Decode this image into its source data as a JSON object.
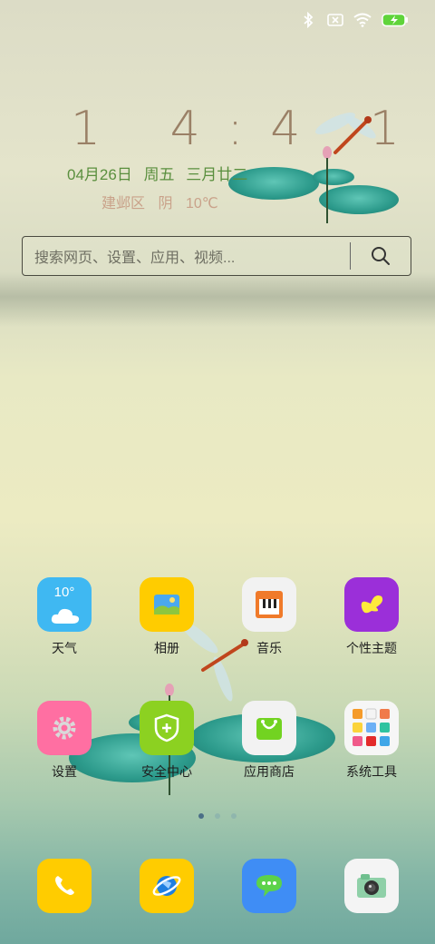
{
  "status_bar": {
    "icons": [
      "bluetooth-icon",
      "no-sim-icon",
      "wifi-icon",
      "battery-charging-icon"
    ]
  },
  "clock": {
    "time": "1 4:4 1",
    "date": "04月26日",
    "weekday": "周五",
    "lunar": "三月廿二",
    "location": "建邺区",
    "weather": "阴",
    "temperature": "10℃"
  },
  "search": {
    "placeholder": "搜索网页、设置、应用、视频...",
    "icon": "search-icon"
  },
  "apps": [
    {
      "label": "天气",
      "icon": "weather-icon",
      "badge": "10°",
      "color": "#3fb8f2"
    },
    {
      "label": "相册",
      "icon": "gallery-icon",
      "color": "#ffcc00"
    },
    {
      "label": "音乐",
      "icon": "music-icon",
      "color": "#f2f2f2"
    },
    {
      "label": "个性主题",
      "icon": "theme-icon",
      "color": "#9b2fd9"
    },
    {
      "label": "设置",
      "icon": "settings-gear-icon",
      "color": "#ff6fa2"
    },
    {
      "label": "安全中心",
      "icon": "security-shield-icon",
      "color": "#8cd121"
    },
    {
      "label": "应用商店",
      "icon": "app-store-icon",
      "color": "#f2f2f2"
    },
    {
      "label": "系统工具",
      "icon": "system-tools-folder-icon",
      "color": "#f6f6f6"
    }
  ],
  "pages": {
    "count": 3,
    "active": 0
  },
  "dock": [
    {
      "icon": "phone-icon",
      "color": "#ffcc00"
    },
    {
      "icon": "browser-icon",
      "color": "#ffcc00"
    },
    {
      "icon": "messages-icon",
      "color": "#3f8df5"
    },
    {
      "icon": "camera-icon",
      "color": "#f4f4f4"
    }
  ]
}
